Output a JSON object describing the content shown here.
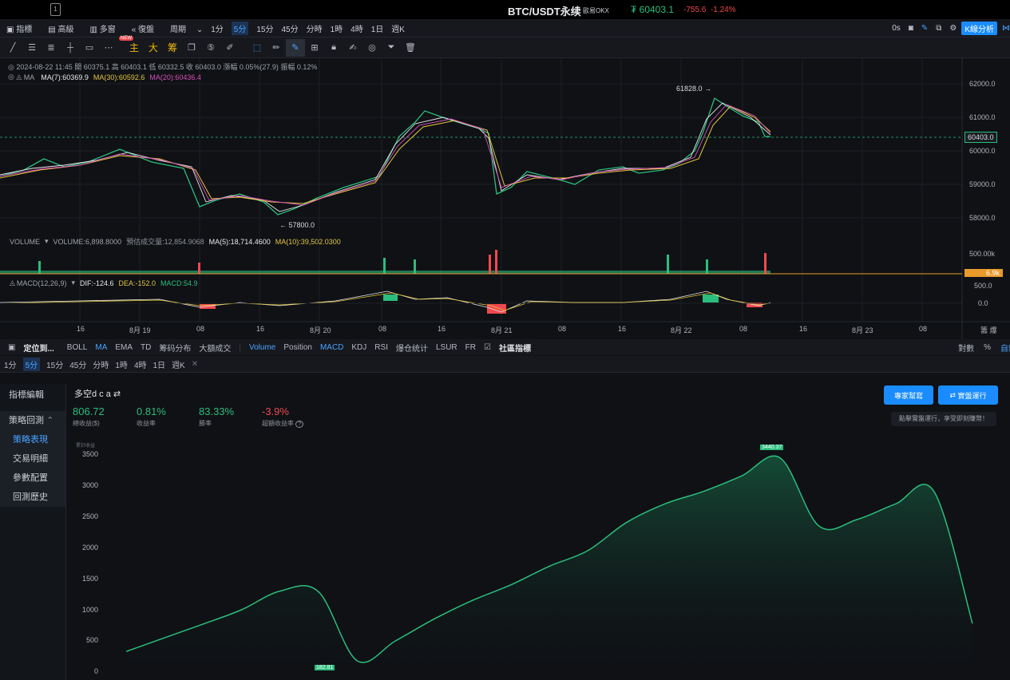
{
  "titlebar": {
    "pair": "BTC/USDT永续",
    "exchange": "歐易OKX",
    "price": "₮ 60403.1",
    "change_abs": "-755.6",
    "change_pct": "-1.24%",
    "window_icon": "1"
  },
  "toolbar1": {
    "items": [
      "指標",
      "高級",
      "多窗",
      "復盤",
      "周期"
    ],
    "timeframes": [
      "1分",
      "5分",
      "15分",
      "45分",
      "分時",
      "1時",
      "4時",
      "1日",
      "週K"
    ],
    "active_timeframe": "5分",
    "right_time": "0s",
    "kline_button": "K線分析"
  },
  "toolbar2": {
    "new_badge": "NEW",
    "yellow_tools": [
      "主",
      "大",
      "筹"
    ]
  },
  "chart": {
    "ohlc_line": "2024-08-22 11:45  開 60375.1  高 60403.1  低 60332.5  收 60403.0  漲幅 0.05%(27.9)  振幅 0.12%",
    "ma_label": "MA",
    "ma7": "MA(7):60369.9",
    "ma30": "MA(30):60592.6",
    "ma20": "MA(20):60436.4",
    "high_marker": "61828.0",
    "low_marker": "57800.0",
    "price_ticks": [
      "62000.0",
      "61000.0",
      "60000.0",
      "59000.0",
      "58000.0"
    ],
    "current_price_tag": "60403.0",
    "volume_label": "VOLUME",
    "volume_value": "VOLUME:6,898.8000",
    "volume_est": "預估成交量:12,854.9068",
    "volume_ma5": "MA(5):18,714.4600",
    "volume_ma10": "MA(10):39,502.0300",
    "volume_ticks": [
      "500.00k"
    ],
    "volume_tag": "6.9k",
    "macd_label": "MACD(12,26,9)",
    "macd_dif": "DIF:-124.6",
    "macd_dea": "DEA:-152.0",
    "macd_val": "MACD:54.9",
    "macd_ticks": [
      "500.0",
      "0.0"
    ],
    "time_ticks": [
      "16",
      "8月 19",
      "08",
      "16",
      "8月 20",
      "08",
      "16",
      "8月 21",
      "08",
      "16",
      "8月 22",
      "08",
      "16",
      "8月 23",
      "08"
    ],
    "axis_corner": "籌 爆"
  },
  "chart_data": {
    "type": "line",
    "title": "",
    "ylabel": "",
    "x": [
      "8月 19",
      "8月 20",
      "8月 21",
      "8月 22"
    ],
    "high": 61828.0,
    "low": 57800.0,
    "last": 60403.0,
    "ylim": [
      57500,
      62300
    ]
  },
  "indicator_tabs": {
    "locate": "定位到...",
    "main": [
      "BOLL",
      "MA",
      "EMA",
      "TD",
      "筹码分布",
      "大額成交"
    ],
    "active_main": "MA",
    "sub": [
      "Volume",
      "Position",
      "MACD",
      "KDJ",
      "RSI",
      "爆仓统计",
      "LSUR",
      "FR"
    ],
    "active_sub": [
      "Volume",
      "MACD"
    ],
    "community": "社區指標",
    "right": [
      "對數",
      "%",
      "自動"
    ]
  },
  "tf_tabs": {
    "items": [
      "1分",
      "5分",
      "15分",
      "45分",
      "分時",
      "1時",
      "4時",
      "1日",
      "週K"
    ],
    "active": "5分",
    "close": "✕"
  },
  "sidebar": {
    "edit": "指標編輯",
    "backtest": "策略回測",
    "items": [
      "策略表現",
      "交易明細",
      "參數配置",
      "回測歷史"
    ],
    "active": "策略表現"
  },
  "backtest": {
    "strategy_name": "多空d c a",
    "stats": [
      {
        "value": "806.72",
        "label": "總收益($)",
        "color": "#2bbd7d"
      },
      {
        "value": "0.81%",
        "label": "收益率",
        "color": "#2bbd7d"
      },
      {
        "value": "83.33%",
        "label": "勝率",
        "color": "#2bbd7d"
      },
      {
        "value": "-3.9%",
        "label": "超額收益率",
        "color": "#f0494f"
      }
    ],
    "buttons": [
      "專家幫寫",
      "實盤運行"
    ],
    "hint": "點擊實盤運行，享受即刻賺幣！",
    "y_caption": "累計收益",
    "y_ticks": [
      "3500",
      "3000",
      "2500",
      "2000",
      "1500",
      "1000",
      "500",
      "0"
    ],
    "max_label": "3440.37",
    "min_label": "182.81"
  },
  "backtest_chart_data": {
    "type": "area",
    "title": "",
    "ylabel": "累計收益",
    "ylim": [
      0,
      3600
    ],
    "values": [
      330,
      550,
      770,
      1000,
      1300,
      1290,
      182.81,
      500,
      850,
      1150,
      1400,
      1700,
      1950,
      2400,
      2700,
      2900,
      3150,
      3440.37,
      2350,
      2450,
      2700,
      2900,
      780
    ]
  }
}
